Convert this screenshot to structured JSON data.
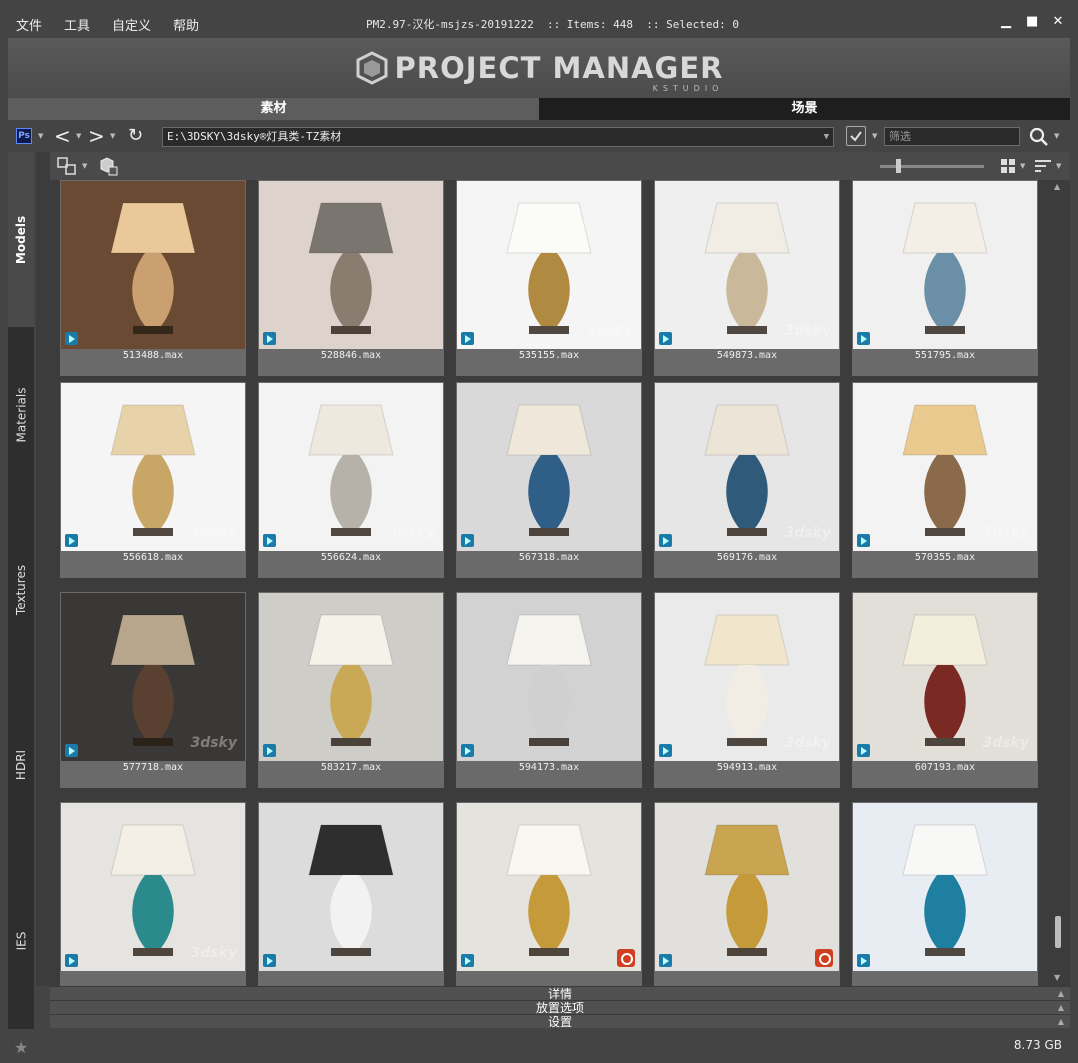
{
  "menu": [
    "文件",
    "工具",
    "自定义",
    "帮助"
  ],
  "window": {
    "title": "PM2.97-汉化-msjzs-20191222  :: Items: 448  :: Selected: 0",
    "minimize": "▁",
    "maximize": "■",
    "close": "✕"
  },
  "logo": {
    "text": "PROJECT MANAGER",
    "subtext": "KSTUDIO"
  },
  "tabs": {
    "materials": "素材",
    "scenes": "场景"
  },
  "pathbar": {
    "ps_label": "Ps",
    "path": "E:\\3DSKY\\3dsky®灯具类-TZ素材",
    "filter_placeholder": "筛选"
  },
  "side_tabs": [
    "Models",
    "Materials",
    "Textures",
    "HDRI",
    "IES"
  ],
  "items": [
    {
      "file": "513488.max",
      "bg": "#6b4a33",
      "shade": "#e9c999",
      "base": "#caa070",
      "wm": "",
      "red": false
    },
    {
      "file": "528846.max",
      "bg": "#ddd3cc",
      "shade": "#7a756e",
      "base": "#8a7d70",
      "wm": "",
      "red": false
    },
    {
      "file": "535155.max",
      "bg": "#f5f5f5",
      "shade": "#fbfbf8",
      "base": "#b08a40",
      "wm": "3dsky",
      "red": false
    },
    {
      "file": "549873.max",
      "bg": "#efefef",
      "shade": "#f2ede4",
      "base": "#c9b89a",
      "wm": "3dsky",
      "red": false
    },
    {
      "file": "551795.max",
      "bg": "#f0f0f0",
      "shade": "#f4efe6",
      "base": "#6a8fa6",
      "wm": "",
      "red": false
    },
    {
      "file": "556618.max",
      "bg": "#f5f5f5",
      "shade": "#e8d2aa",
      "base": "#c8a766",
      "wm": "3dsky",
      "red": false
    },
    {
      "file": "556624.max",
      "bg": "#f3f3f3",
      "shade": "#eee8de",
      "base": "#b6b2aa",
      "wm": "3dsky",
      "red": false
    },
    {
      "file": "567318.max",
      "bg": "#d9d9d9",
      "shade": "#efe8da",
      "base": "#2f5f86",
      "wm": "",
      "red": false
    },
    {
      "file": "569176.max",
      "bg": "#e6e6e6",
      "shade": "#ece4d6",
      "base": "#305a7a",
      "wm": "3dsky",
      "red": false
    },
    {
      "file": "570355.max",
      "bg": "#f3f3f3",
      "shade": "#e9c98e",
      "base": "#8a6a4a",
      "wm": "3dsky",
      "red": false
    },
    {
      "file": "577718.max",
      "bg": "#3a3836",
      "shade": "#b7a68b",
      "base": "#5a4030",
      "wm": "3dsky",
      "red": false
    },
    {
      "file": "583217.max",
      "bg": "#cfcdc8",
      "shade": "#f5f2ea",
      "base": "#c9a856",
      "wm": "",
      "red": false
    },
    {
      "file": "594173.max",
      "bg": "#d2d2d2",
      "shade": "#f5f3ee",
      "base": "#d0d0d0",
      "wm": "",
      "red": false
    },
    {
      "file": "594913.max",
      "bg": "#eaeaea",
      "shade": "#f1e6cc",
      "base": "#f1ede4",
      "wm": "3dsky",
      "red": false
    },
    {
      "file": "607193.max",
      "bg": "#e2dfd9",
      "shade": "#f4eedd",
      "base": "#7a2a22",
      "wm": "3dsky",
      "red": false
    },
    {
      "file": "",
      "bg": "#e6e4e0",
      "shade": "#f3efe6",
      "base": "#2a8a8c",
      "wm": "3dsky",
      "red": false
    },
    {
      "file": "",
      "bg": "#dcdcdc",
      "shade": "#2e2e2e",
      "base": "#f2f2f2",
      "wm": "",
      "red": false
    },
    {
      "file": "",
      "bg": "#e5e3de",
      "shade": "#f8f6f1",
      "base": "#c59a3a",
      "wm": "",
      "red": true
    },
    {
      "file": "",
      "bg": "#e2e0dc",
      "shade": "#c9a451",
      "base": "#c59a3a",
      "wm": "",
      "red": true
    },
    {
      "file": "",
      "bg": "#e7edf3",
      "shade": "#f8f8f6",
      "base": "#1e7fa0",
      "wm": "",
      "red": false
    }
  ],
  "panels": {
    "details": "详情",
    "placement": "放置选项",
    "settings": "设置"
  },
  "status": {
    "disk": "8.73 GB"
  }
}
